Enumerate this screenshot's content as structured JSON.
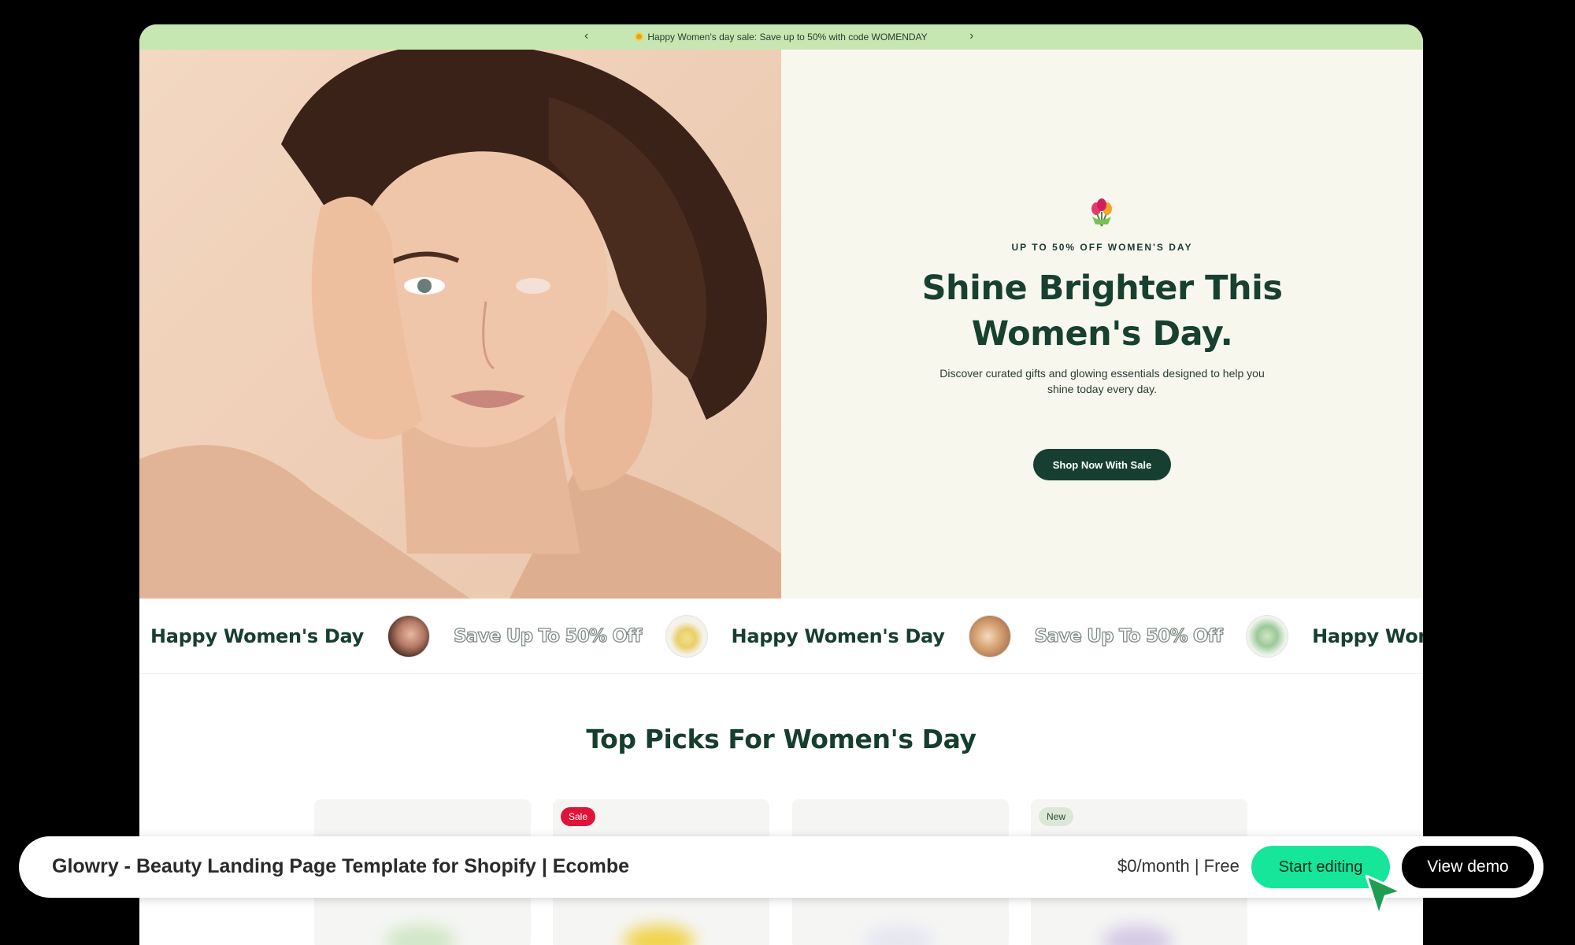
{
  "announcement": {
    "prev_icon": "‹",
    "next_icon": "›",
    "text": "Happy Women's day sale: Save up to 50% with code WOMENDAY"
  },
  "hero": {
    "eyebrow": "UP TO 50% OFF WOMEN'S DAY",
    "headline": "Shine Brighter This Women's Day.",
    "subtext": "Discover curated gifts and glowing essentials designed to help you shine today every day.",
    "cta_label": "Shop Now With Sale"
  },
  "marquee": {
    "items": [
      "Happy Women's  Day",
      "Save Up To 50% Off",
      "Happy Women's  Day",
      "Save Up To 50% Off",
      "Happy Woman"
    ]
  },
  "section": {
    "title": "Top Picks For Women's Day",
    "badges": {
      "sale": "Sale",
      "new": "New"
    }
  },
  "bottom_bar": {
    "title": "Glowry - Beauty Landing Page Template for Shopify | Ecombe",
    "price": "$0/month | Free",
    "start_label": "Start editing",
    "demo_label": "View demo"
  },
  "colors": {
    "announcement_bg": "#c6e7b1",
    "hero_copy_bg": "#f7f7ee",
    "brand_dark_green": "#163f32",
    "start_button": "#15e69a",
    "sale_badge": "#e0143a"
  },
  "icons": [
    "chevron-left-icon",
    "chevron-right-icon",
    "sun-emoji-icon",
    "tulip-bouquet-icon",
    "cursor-arrow-icon"
  ]
}
